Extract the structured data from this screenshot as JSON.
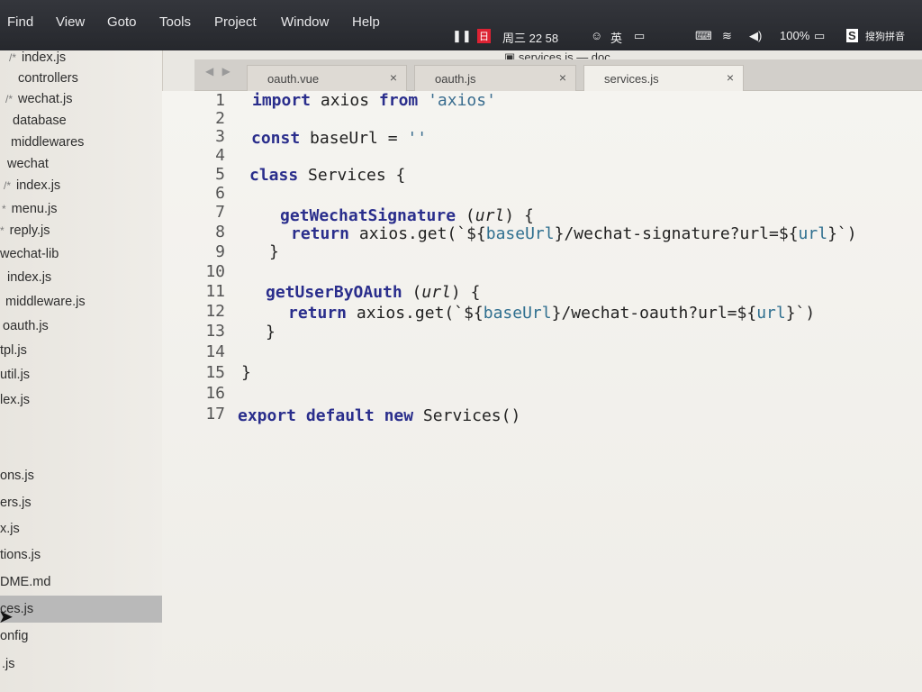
{
  "menubar": {
    "items": [
      "Find",
      "View",
      "Goto",
      "Tools",
      "Project",
      "Window",
      "Help"
    ],
    "status": {
      "weekday_time": "周三 22 58",
      "input_method": "英",
      "battery": "100%",
      "ime_name": "搜狗拼音"
    }
  },
  "window": {
    "title": "services.js — doc"
  },
  "sidebar": {
    "items": [
      {
        "mark": "/*",
        "label": "index.js"
      },
      {
        "mark": "",
        "label": "controllers"
      },
      {
        "mark": "/*",
        "label": "wechat.js"
      },
      {
        "mark": "",
        "label": "database"
      },
      {
        "mark": "",
        "label": "middlewares"
      },
      {
        "mark": "",
        "label": "wechat"
      },
      {
        "mark": "/*",
        "label": "index.js"
      },
      {
        "mark": "*",
        "label": "menu.js"
      },
      {
        "mark": "*",
        "label": "reply.js"
      },
      {
        "mark": "",
        "label": "wechat-lib"
      },
      {
        "mark": "",
        "label": "index.js"
      },
      {
        "mark": "",
        "label": "middleware.js"
      },
      {
        "mark": "",
        "label": "oauth.js"
      },
      {
        "mark": "",
        "label": "tpl.js"
      },
      {
        "mark": "",
        "label": "util.js"
      },
      {
        "mark": "",
        "label": "lex.js"
      },
      {
        "mark": "",
        "label": "ons.js"
      },
      {
        "mark": "",
        "label": "ers.js"
      },
      {
        "mark": "",
        "label": "x.js"
      },
      {
        "mark": "",
        "label": "tions.js"
      },
      {
        "mark": "",
        "label": "DME.md"
      },
      {
        "mark": "",
        "label": "ces.js"
      },
      {
        "mark": "",
        "label": "onfig"
      },
      {
        "mark": "",
        "label": ".js"
      }
    ]
  },
  "tabs": [
    {
      "label": "oauth.vue",
      "close": "×"
    },
    {
      "label": "oauth.js",
      "close": "×"
    },
    {
      "label": "services.js",
      "close": "×"
    }
  ],
  "editor": {
    "line_numbers": [
      "1",
      "2",
      "3",
      "4",
      "5",
      "6",
      "7",
      "8",
      "9",
      "10",
      "11",
      "12",
      "13",
      "14",
      "15",
      "16",
      "17"
    ],
    "lines": {
      "l1": {
        "kw1": "import",
        "a": " axios ",
        "kw2": "from",
        "s": " 'axios'"
      },
      "l3": {
        "kw": "const",
        "a": " baseUrl = ",
        "s": "''"
      },
      "l5": {
        "kw": "class",
        "a": " Services {"
      },
      "l7": {
        "fn": "getWechatSignature",
        "a": " (",
        "p": "url",
        "b": ") {"
      },
      "l8": {
        "kw": "return",
        "a": " axios.get(`${",
        "v1": "baseUrl",
        "b": "}/wechat-signature?url=${",
        "v2": "url",
        "c": "}`)"
      },
      "l9": {
        "a": "}"
      },
      "l11": {
        "fn": "getUserByOAuth",
        "a": " (",
        "p": "url",
        "b": ") {"
      },
      "l12": {
        "kw": "return",
        "a": " axios.get(`${",
        "v1": "baseUrl",
        "b": "}/wechat-oauth?url=${",
        "v2": "url",
        "c": "}`)"
      },
      "l13": {
        "a": "}"
      },
      "l15": {
        "a": "}"
      },
      "l17": {
        "kw1": "export",
        "kw2": "default",
        "kw3": "new",
        "a": " Services()"
      }
    }
  }
}
